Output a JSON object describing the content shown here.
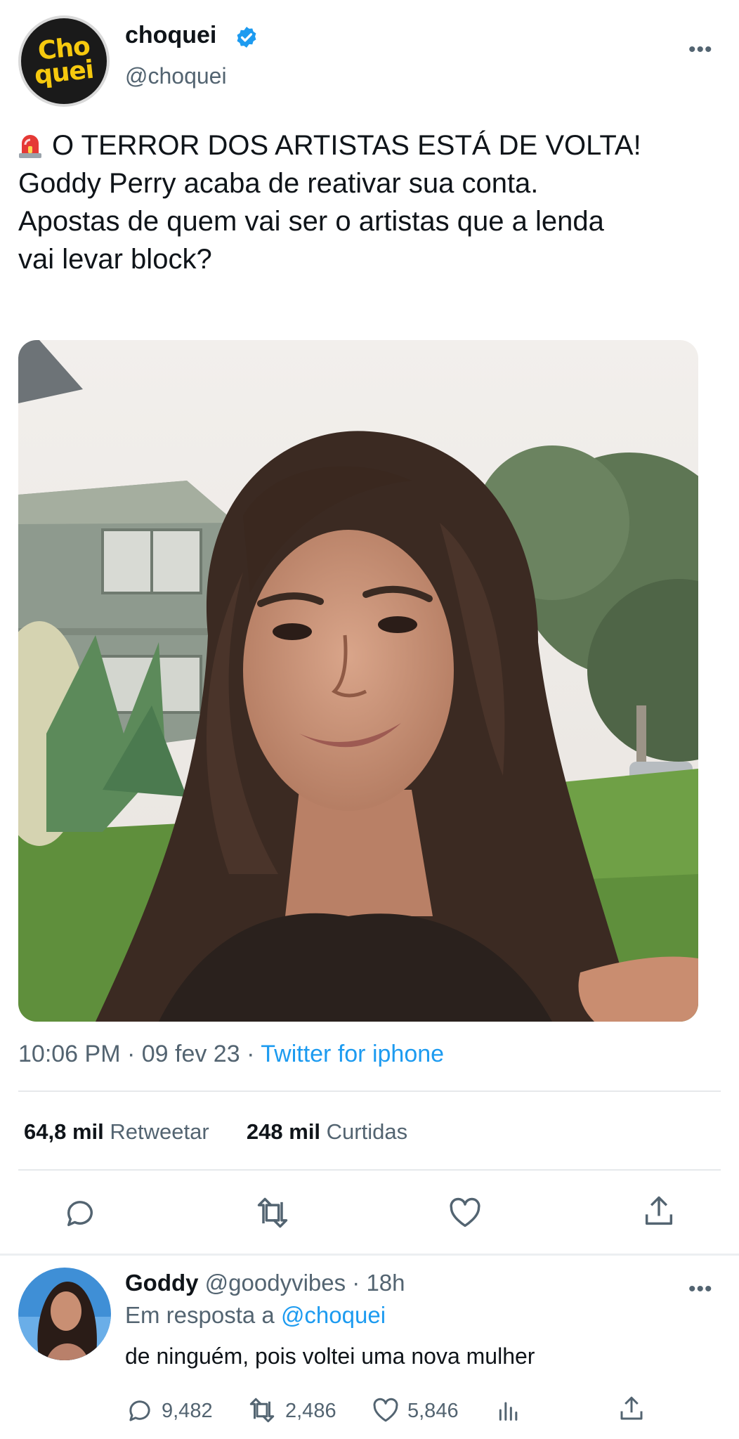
{
  "tweet": {
    "author": {
      "name": "choquei",
      "handle": "@choquei",
      "logo_lines": [
        "Cho",
        "quei"
      ],
      "verified": true
    },
    "more_label": "•••",
    "text_lines": [
      "O TERROR DOS ARTISTAS ESTÁ DE VOLTA!",
      "Goddy Perry acaba de reativar sua conta.",
      "Apostas de quem vai ser o artistas que a lenda",
      "vai levar block?"
    ],
    "leading_emoji": "siren-icon",
    "time": "10:06 PM · 09 fev 23 ·",
    "source": "Twitter for iphone",
    "retweets_count": "64,8 mil",
    "retweets_label": "Retweetar",
    "likes_count": "248 mil",
    "likes_label": "Curtidas"
  },
  "reply": {
    "name": "Goddy",
    "handle_time": "@goodyvibes · 18h",
    "in_reply_prefix": "Em resposta a",
    "in_reply_mention": "@choquei",
    "text": "de ninguém, pois voltei uma nova mulher",
    "more_label": "•••",
    "replies": "9,482",
    "retweets": "2,486",
    "likes": "5,846"
  },
  "colors": {
    "accent": "#1d9bf0",
    "secondary_text": "#536471",
    "logo_yellow": "#f6c90e"
  }
}
